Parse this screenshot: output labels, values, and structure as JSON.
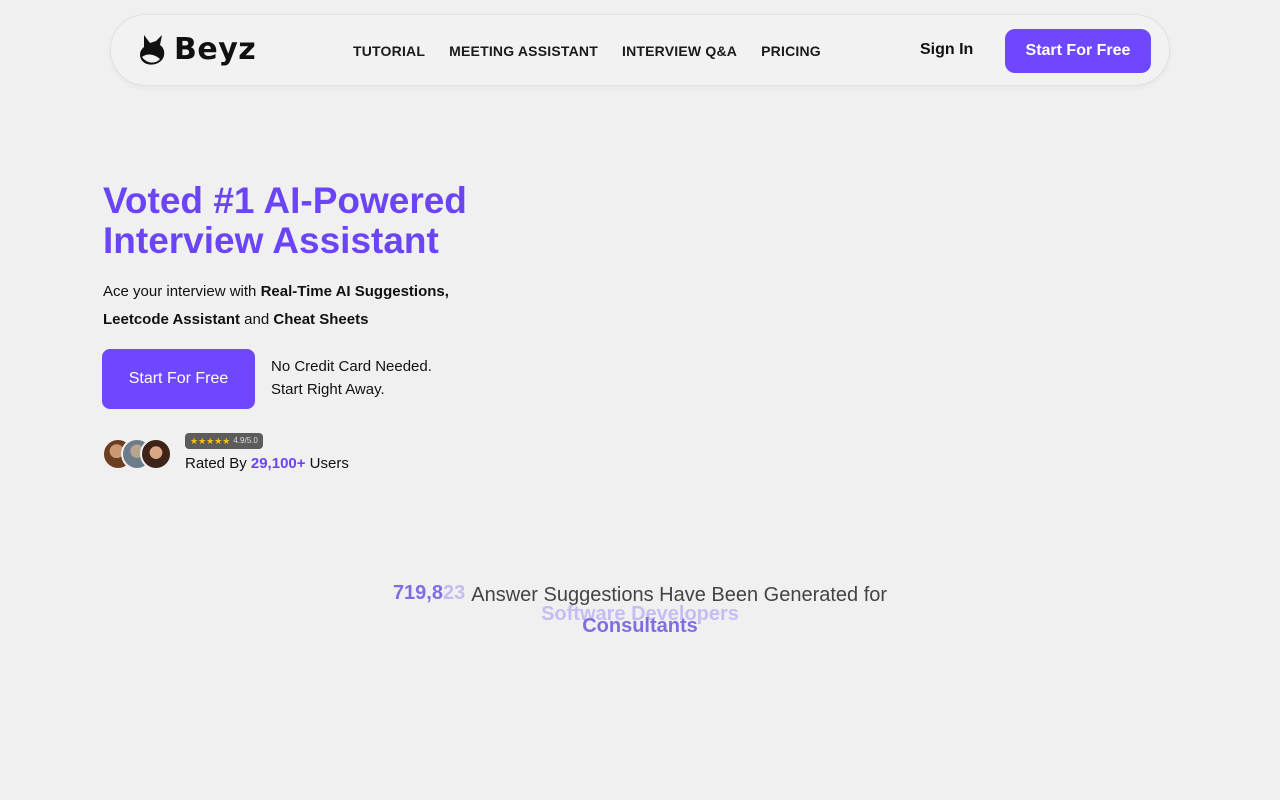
{
  "nav": {
    "logo_text": "Beyz",
    "links": [
      "TUTORIAL",
      "MEETING ASSISTANT",
      "INTERVIEW Q&A",
      "PRICING"
    ],
    "sign_in": "Sign In",
    "cta": "Start For Free"
  },
  "hero": {
    "title": "Voted #1 AI-Powered Interview Assistant",
    "sub_prefix": "Ace your interview with ",
    "sub_bold1": "Real-Time AI Suggestions,",
    "sub_bold2": "Leetcode Assistant",
    "sub_mid": " and ",
    "sub_bold3": "Cheat Sheets",
    "cta": "Start For Free",
    "note_line1": "No Credit Card Needed.",
    "note_line2": "Start Right Away."
  },
  "social_proof": {
    "rating": "4.9/5.0",
    "stars": "★★★★★",
    "rated_prefix": "Rated By ",
    "count": "29,100+",
    "rated_suffix": " Users"
  },
  "counter": {
    "number_main": "719,8",
    "number_flip": "23",
    "text": "Answer Suggestions Have Been Generated for",
    "role_previous": "Software Developers",
    "role_current": "Consultants"
  },
  "colors": {
    "brand": "#6f47ff",
    "title": "#6b45f5",
    "background": "#f0f0f0"
  }
}
